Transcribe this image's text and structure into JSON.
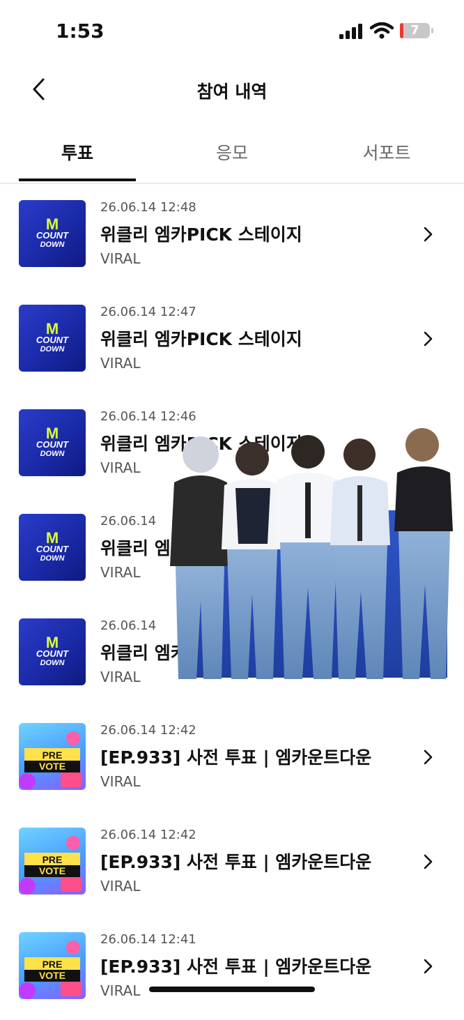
{
  "status_bar": {
    "time": "1:53",
    "battery": "7"
  },
  "header": {
    "title": "참여 내역"
  },
  "tabs": [
    {
      "label": "투표",
      "active": true
    },
    {
      "label": "응모",
      "active": false
    },
    {
      "label": "서포트",
      "active": false
    }
  ],
  "items": [
    {
      "date": "26.06.14 12:48",
      "title": "위클리 엠카PICK 스테이지",
      "source": "VIRAL",
      "thumb": "mcountdown"
    },
    {
      "date": "26.06.14 12:47",
      "title": "위클리 엠카PICK 스테이지",
      "source": "VIRAL",
      "thumb": "mcountdown"
    },
    {
      "date": "26.06.14 12:46",
      "title": "위클리 엠카PICK 스테이지",
      "source": "VIRAL",
      "thumb": "mcountdown"
    },
    {
      "date": "26.06.14",
      "title": "위클리 엠카PICK 스테이지",
      "source": "VIRAL",
      "thumb": "mcountdown"
    },
    {
      "date": "26.06.14",
      "title": "위클리 엠카PICK 스테이지",
      "source": "VIRAL",
      "thumb": "mcountdown"
    },
    {
      "date": "26.06.14 12:42",
      "title": "[EP.933] 사전 투표 | 엠카운트다운",
      "source": "VIRAL",
      "thumb": "prevote"
    },
    {
      "date": "26.06.14 12:42",
      "title": "[EP.933] 사전 투표 | 엠카운트다운",
      "source": "VIRAL",
      "thumb": "prevote"
    },
    {
      "date": "26.06.14 12:41",
      "title": "[EP.933] 사전 투표 | 엠카운트다운",
      "source": "VIRAL",
      "thumb": "prevote"
    }
  ],
  "thumb_text": {
    "mcountdown": {
      "m": "M",
      "line1": "COUNT",
      "line2": "DOWN"
    },
    "prevote": {
      "line1": "PRE",
      "line2": "VOTE"
    }
  },
  "colors": {
    "accent": "#111111",
    "mcountdown_blue": "#1a2aa8",
    "prevote_yellow": "#ffe14a"
  },
  "icons": {
    "back": "chevron-left-icon",
    "row_arrow": "chevron-right-icon",
    "signal": "cellular-signal-icon",
    "wifi": "wifi-icon",
    "battery": "battery-icon"
  }
}
